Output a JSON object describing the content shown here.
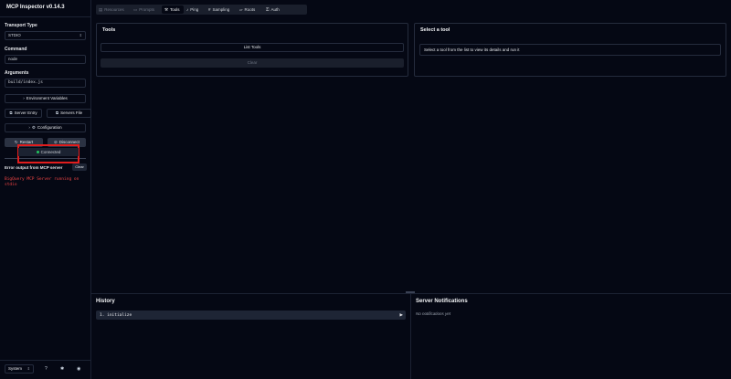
{
  "app": {
    "title": "MCP Inspector v0.14.3"
  },
  "sidebar": {
    "transport_label": "Transport Type",
    "transport_value": "STDIO",
    "command_label": "Command",
    "command_value": "node",
    "arguments_label": "Arguments",
    "arguments_value": "build/index.js",
    "env_button": "Environment Variables",
    "server_entry_button": "Server Entry",
    "servers_file_button": "Servers File",
    "configuration_button": "Configuration",
    "restart_button": "Restart",
    "disconnect_button": "Disconnect",
    "status_text": "Connected",
    "status_color": "#22c55e",
    "error_label": "Error output from MCP server",
    "clear_button": "Clear",
    "error_text": "BigQuery MCP Server running on stdio",
    "theme_value": "System"
  },
  "tabs": [
    {
      "label": "Resources",
      "icon": "resources-icon",
      "state": "disabled"
    },
    {
      "label": "Prompts",
      "icon": "prompts-icon",
      "state": "disabled"
    },
    {
      "label": "Tools",
      "icon": "wrench-icon",
      "state": "active"
    },
    {
      "label": "Ping",
      "icon": "bell-icon",
      "state": "enabled"
    },
    {
      "label": "Sampling",
      "icon": "hash-icon",
      "state": "enabled"
    },
    {
      "label": "Roots",
      "icon": "folder-icon",
      "state": "enabled"
    },
    {
      "label": "Auth",
      "icon": "key-icon",
      "state": "enabled"
    }
  ],
  "tools_panel": {
    "title": "Tools",
    "list_button": "List Tools",
    "clear_button": "Clear"
  },
  "select_panel": {
    "title": "Select a tool",
    "message": "Select a tool from the list to view its details and run it"
  },
  "history": {
    "title": "History",
    "items": [
      {
        "label": "1. initialize"
      }
    ]
  },
  "notifications": {
    "title": "Server Notifications",
    "empty_text": "No notifications yet"
  },
  "highlight_color": "#e11d1d",
  "error_color": "#ef4444"
}
